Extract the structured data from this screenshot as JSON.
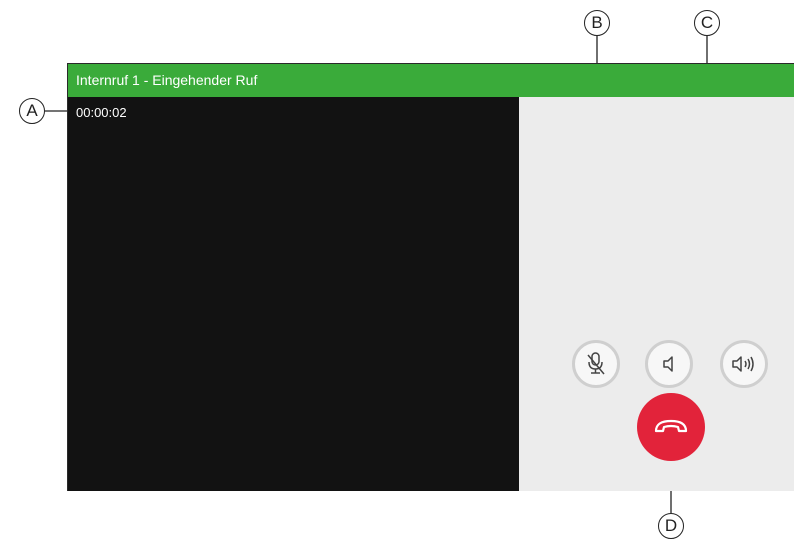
{
  "window": {
    "title": "Internruf 1 - Eingehender Ruf"
  },
  "call": {
    "duration": "00:00:02"
  },
  "controls": {
    "mute": {
      "icon": "microphone-muted-icon"
    },
    "volume_down": {
      "icon": "speaker-low-icon"
    },
    "volume_up": {
      "icon": "speaker-high-icon"
    },
    "hangup": {
      "icon": "phone-hangup-icon"
    }
  },
  "callouts": {
    "a": "A",
    "b": "B",
    "c": "C",
    "d": "D"
  },
  "colors": {
    "titlebar": "#3aab3a",
    "hangup": "#e2233a",
    "video_bg": "#121212",
    "panel_bg": "#ececec"
  }
}
